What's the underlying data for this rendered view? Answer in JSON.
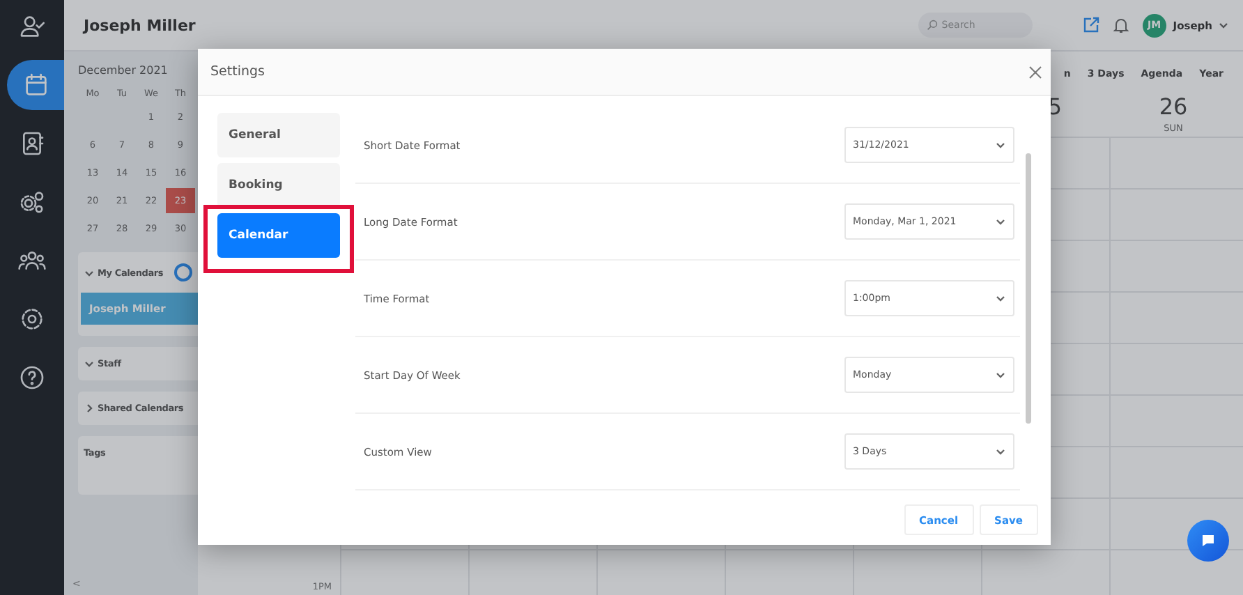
{
  "sidebar": {
    "items": [
      {
        "kind": "user-check",
        "selected": false
      },
      {
        "kind": "calendar",
        "selected": true
      },
      {
        "kind": "contact",
        "selected": false
      },
      {
        "kind": "gears",
        "selected": false
      },
      {
        "kind": "group",
        "selected": false
      },
      {
        "kind": "gear",
        "selected": false
      },
      {
        "kind": "help",
        "selected": false
      }
    ]
  },
  "header": {
    "title": "Joseph Miller",
    "search": {
      "placeholder": "Search"
    },
    "user": {
      "initials": "JM",
      "name": "Joseph"
    }
  },
  "mini_calendar": {
    "month": "December 2021",
    "weekdays": [
      "Mo",
      "Tu",
      "We",
      "Th"
    ],
    "weeks": [
      [
        {
          "day": "1",
          "selected": false
        },
        {
          "day": "2",
          "selected": false
        }
      ],
      [
        {
          "day": "6",
          "selected": false
        },
        {
          "day": "7",
          "selected": false
        },
        {
          "day": "8",
          "selected": false
        },
        {
          "day": "9",
          "selected": false
        }
      ],
      [
        {
          "day": "13",
          "selected": false
        },
        {
          "day": "14",
          "selected": false
        },
        {
          "day": "15",
          "selected": false
        },
        {
          "day": "16",
          "selected": false
        }
      ],
      [
        {
          "day": "20",
          "selected": false
        },
        {
          "day": "21",
          "selected": false
        },
        {
          "day": "22",
          "selected": false
        },
        {
          "day": "23",
          "selected": true
        }
      ],
      [
        {
          "day": "27",
          "selected": false
        },
        {
          "day": "28",
          "selected": false
        },
        {
          "day": "29",
          "selected": false
        },
        {
          "day": "30",
          "selected": false
        }
      ]
    ]
  },
  "panels": [
    {
      "kind": "collapsible",
      "title": "My Calendars",
      "expanded": true,
      "items": [
        {
          "name": "Joseph Miller"
        }
      ]
    },
    {
      "kind": "collapsible",
      "title": "Staff",
      "expanded": true
    },
    {
      "kind": "collapsible",
      "title": "Shared Calendars",
      "expanded": false
    },
    {
      "kind": "plain",
      "title": "Tags"
    }
  ],
  "collapse_label": "<",
  "view_tabs": [
    {
      "label": "n",
      "selected": false
    },
    {
      "label": "3 Days",
      "selected": false
    },
    {
      "label": "Agenda",
      "selected": false
    },
    {
      "label": "Year",
      "selected": false
    }
  ],
  "days": [
    {
      "date": "5"
    },
    {
      "date": "26",
      "weekday": "SUN"
    }
  ],
  "time_labels": [
    "1PM"
  ],
  "dialog": {
    "title": "Settings",
    "nav": [
      {
        "label": "General",
        "selected": false,
        "highlighted": false
      },
      {
        "label": "Booking",
        "selected": false,
        "highlighted": false
      },
      {
        "label": "Calendar",
        "selected": true,
        "highlighted": true
      }
    ],
    "settings": [
      {
        "label": "Short Date Format",
        "value": "31/12/2021"
      },
      {
        "label": "Long Date Format",
        "value": "Monday, Mar 1, 2021"
      },
      {
        "label": "Time Format",
        "value": "1:00pm"
      },
      {
        "label": "Start Day Of Week",
        "value": "Monday"
      },
      {
        "label": "Custom View",
        "value": "3 Days"
      }
    ],
    "buttons": [
      {
        "label": "Cancel"
      },
      {
        "label": "Save"
      }
    ]
  }
}
